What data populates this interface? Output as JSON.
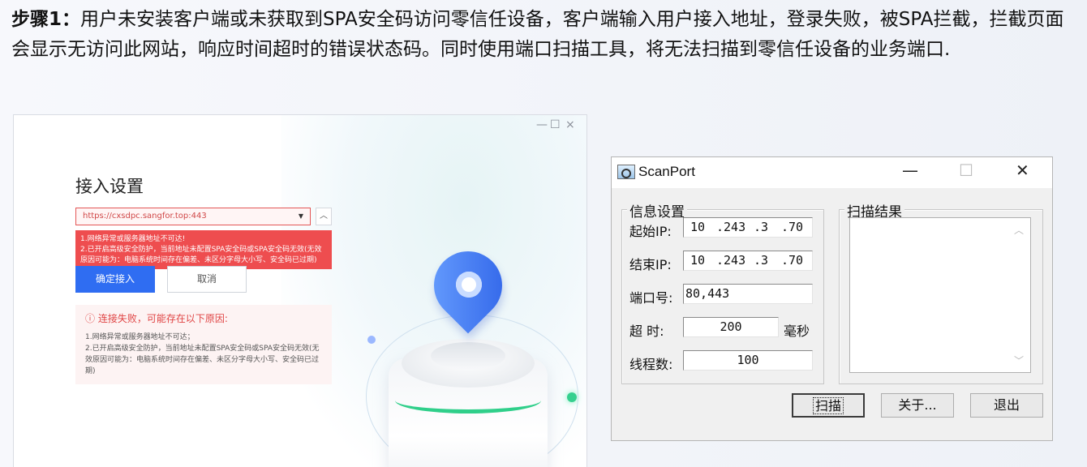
{
  "header": {
    "step": "步骤1：",
    "text": "用户未安装客户端或未获取到SPA安全码访问零信任设备，客户端输入用户接入地址，登录失败，被SPA拦截，拦截页面会显示无访问此网站，响应时间超时的错误状态码。同时使用端口扫描工具，将无法扫描到零信任设备的业务端口."
  },
  "client": {
    "window_controls": {
      "minimize": "—",
      "maximize": "☐",
      "close": "×"
    },
    "title": "接入设置",
    "address": "https://cxsdpc.sangfor.top:443",
    "tooltip_lines": [
      "1.网络异常或服务器地址不可达!",
      "2.已开启高级安全防护，当前地址未配置SPA安全码或SPA安全码无效(无效",
      "原因可能为：电脑系统时间存在偏差、未区分字母大小写、安全码已过期)"
    ],
    "confirm_label": "确定接入",
    "cancel_label": "取消",
    "fail_title": "ⓘ  连接失败，可能存在以下原因:",
    "fail_lines": [
      "1.网络异常或服务器地址不可达；",
      "2.已开启高级安全防护，当前地址未配置SPA安全码或SPA安全码无效(无",
      "效原因可能为：电脑系统时间存在偏差、未区分字母大小写、安全码已过",
      "期)"
    ]
  },
  "scanport": {
    "title": "ScanPort",
    "window_controls": {
      "minimize": "—",
      "maximize": "☐",
      "close": "✕"
    },
    "info_group": "信息设置",
    "result_group": "扫描结果",
    "start_ip_label": "起始IP:",
    "start_ip": [
      "10",
      ".243",
      ".3",
      ".70"
    ],
    "end_ip_label": "结束IP:",
    "end_ip": [
      "10",
      ".243",
      ".3",
      ".70"
    ],
    "port_label": "端口号:",
    "port_value": "80,443",
    "timeout_label": "超  时:",
    "timeout_value": "200",
    "timeout_unit": "毫秒",
    "threads_label": "线程数:",
    "threads_value": "100",
    "scan_button": "扫描",
    "about_button": "关于...",
    "exit_button": "退出"
  }
}
